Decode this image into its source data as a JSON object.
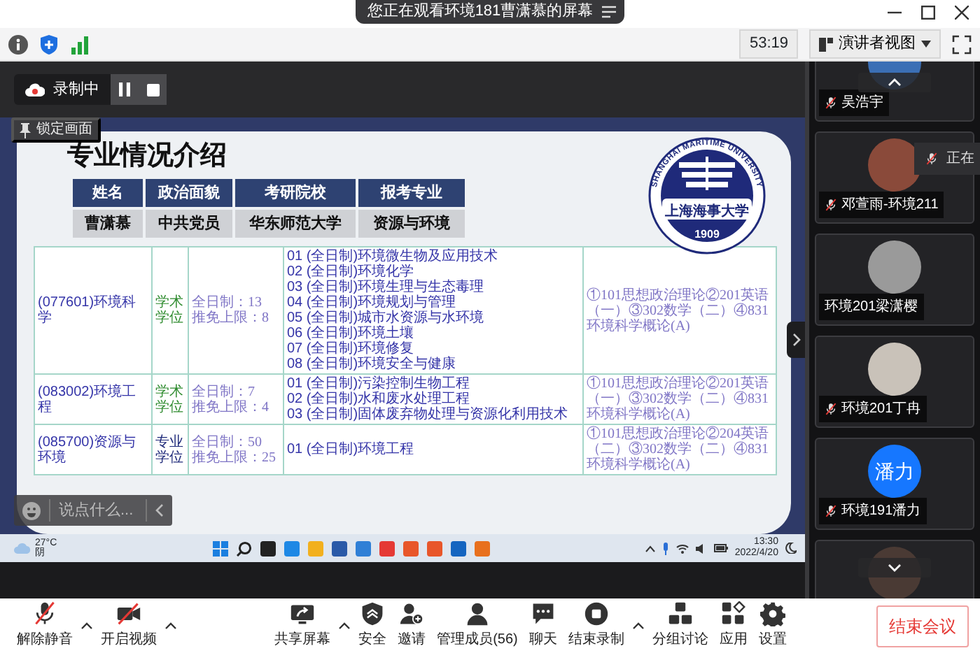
{
  "banner": {
    "title": "您正在观看环境181曹潇慕的屏幕"
  },
  "status_bar": {
    "timer": "53:19",
    "view_mode": "演讲者视图"
  },
  "recording": {
    "label": "录制中"
  },
  "lock_view": {
    "label": "锁定画面"
  },
  "slide": {
    "title": "专业情况介绍",
    "logo": {
      "ring_text": "SHANGHAI MARITIME UNIVERSITY",
      "name": "上海海事大学",
      "year": "1909"
    },
    "info_table": {
      "columns": [
        "姓名",
        "政治面貌",
        "考研院校",
        "报考专业"
      ],
      "rows": [
        [
          "曹潇慕",
          "中共党员",
          "华东师范大学",
          "资源与环境"
        ]
      ]
    },
    "program_table": {
      "rows": [
        {
          "major": "(077601)环境科学",
          "degree": "学术学位",
          "color": "#2e8b2e",
          "quota": [
            "全日制：13",
            "推免上限：8"
          ],
          "directions": [
            "01 (全日制)环境微生物及应用技术",
            "02 (全日制)环境化学",
            "03 (全日制)环境生理与生态毒理",
            "04 (全日制)环境规划与管理",
            "05 (全日制)城市水资源与水环境",
            "06 (全日制)环境土壤",
            "07 (全日制)环境修复",
            "08 (全日制)环境安全与健康"
          ],
          "exams": "①101思想政治理论②201英语（一）③302数学（二）④831环境科学概论(A)"
        },
        {
          "major": "(083002)环境工程",
          "degree": "学术学位",
          "color": "#2e8b2e",
          "quota": [
            "全日制：7",
            "推免上限：4"
          ],
          "directions": [
            "01 (全日制)污染控制生物工程",
            "02 (全日制)水和废水处理工程",
            "03 (全日制)固体废弃物处理与资源化利用技术"
          ],
          "exams": "①101思想政治理论②201英语（一）③302数学（二）④831环境科学概论(A)"
        },
        {
          "major": "(085700)资源与环境",
          "degree": "专业学位",
          "color": "#1f2a7a",
          "quota": [
            "全日制：50",
            "推免上限：25"
          ],
          "directions": [
            "01 (全日制)环境工程"
          ],
          "exams": "①101思想政治理论②204英语（二）③302数学（二）④831环境科学概论(A)"
        }
      ]
    }
  },
  "chat": {
    "placeholder": "说点什么..."
  },
  "taskbar": {
    "temperature": "27°C",
    "weather": "阴",
    "time": "13:30",
    "date": "2022/4/20"
  },
  "participants": [
    {
      "name": "吴浩宇",
      "muted": true
    },
    {
      "name": "邓萱雨-环境211",
      "muted": true
    },
    {
      "name": "环境201梁潇樱",
      "muted": false
    },
    {
      "name": "环境201丁冉",
      "muted": true
    },
    {
      "name": "环境191潘力",
      "muted": true,
      "initials": "潘力"
    }
  ],
  "tooltip": {
    "text": "正在"
  },
  "controls": [
    {
      "kind": "mic",
      "label": "解除静音",
      "has_menu": true
    },
    {
      "kind": "video",
      "label": "开启视频",
      "has_menu": true
    },
    {
      "kind": "share",
      "label": "共享屏幕",
      "has_menu": true
    },
    {
      "kind": "security",
      "label": "安全",
      "has_menu": false
    },
    {
      "kind": "invite",
      "label": "邀请",
      "has_menu": false
    },
    {
      "kind": "members",
      "label": "管理成员(56)",
      "has_menu": false
    },
    {
      "kind": "chat",
      "label": "聊天",
      "has_menu": false
    },
    {
      "kind": "record",
      "label": "结束录制",
      "has_menu": true
    },
    {
      "kind": "breakout",
      "label": "分组讨论",
      "has_menu": false
    },
    {
      "kind": "apps",
      "label": "应用",
      "has_menu": false
    },
    {
      "kind": "settings",
      "label": "设置",
      "has_menu": false
    }
  ],
  "end_meeting": {
    "label": "结束会议"
  }
}
